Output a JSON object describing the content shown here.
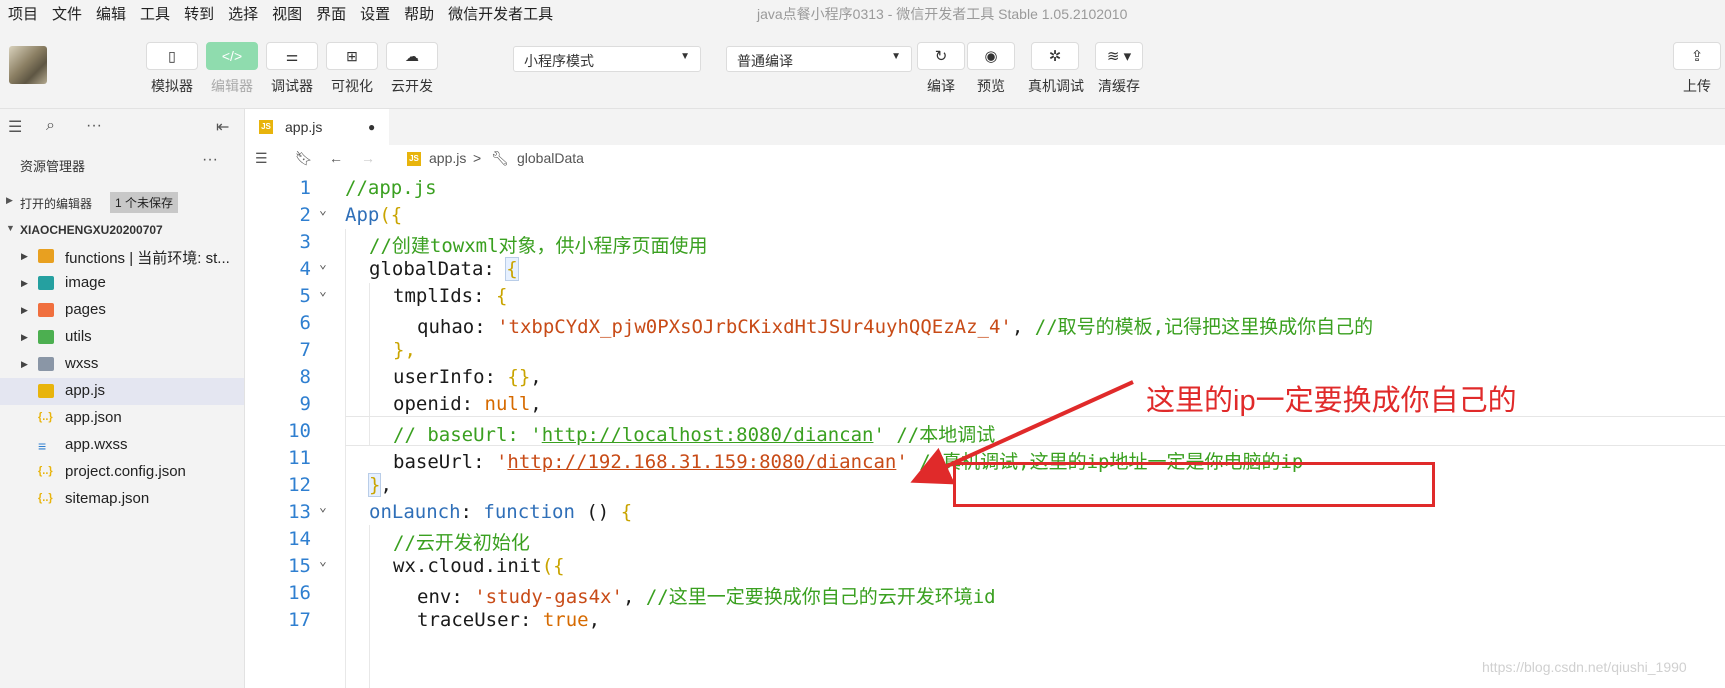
{
  "menu": [
    "项目",
    "文件",
    "编辑",
    "工具",
    "转到",
    "选择",
    "视图",
    "界面",
    "设置",
    "帮助",
    "微信开发者工具"
  ],
  "window_title": "java点餐小程序0313 - 微信开发者工具 Stable 1.05.2102010",
  "toolbar": {
    "simulator": "模拟器",
    "editor": "编辑器",
    "debugger": "调试器",
    "visual": "可视化",
    "cloud": "云开发",
    "mode_select": "小程序模式",
    "compile_select": "普通编译",
    "compile": "编译",
    "preview": "预览",
    "remote_debug": "真机调试",
    "clear_cache": "清缓存",
    "upload": "上传"
  },
  "explorer": {
    "title": "资源管理器",
    "open_editors": "打开的编辑器",
    "unsaved_badge": "1 个未保存",
    "project": "XIAOCHENGXU20200707",
    "items": [
      {
        "name": "functions | 当前环境: st...",
        "icon": "folder-functions-icon",
        "color": "#e8a020"
      },
      {
        "name": "image",
        "icon": "folder-image-icon",
        "color": "#25a0a0"
      },
      {
        "name": "pages",
        "icon": "folder-pages-icon",
        "color": "#f06f3e"
      },
      {
        "name": "utils",
        "icon": "folder-utils-icon",
        "color": "#4caf50"
      },
      {
        "name": "wxss",
        "icon": "folder-icon",
        "color": "#8a96a6"
      },
      {
        "name": "app.js",
        "icon": "js-file-icon",
        "color": "#e8b40c"
      },
      {
        "name": "app.json",
        "icon": "json-file-icon",
        "color": "#e8b40c"
      },
      {
        "name": "app.wxss",
        "icon": "css-file-icon",
        "color": "#2f7fd0"
      },
      {
        "name": "project.config.json",
        "icon": "json-file-icon",
        "color": "#e8b40c"
      },
      {
        "name": "sitemap.json",
        "icon": "json-file-icon",
        "color": "#e8b40c"
      }
    ]
  },
  "tab": {
    "name": "app.js",
    "modified": "●",
    "icon_text": "JS"
  },
  "breadcrumb": {
    "file": "app.js",
    "separator": ">",
    "symbol": "globalData"
  },
  "code": {
    "line_numbers": [
      "1",
      "2",
      "3",
      "4",
      "5",
      "6",
      "7",
      "8",
      "9",
      "10",
      "11",
      "12",
      "13",
      "14",
      "15",
      "16",
      "17"
    ],
    "l1": "//app.js",
    "l2_fn": "App",
    "l2_br": "({",
    "l3": "//创建towxml对象，供小程序页面使用",
    "l4_key": "globalData",
    "l4_colon": ": ",
    "l4_br": "{",
    "l5_key": "tmplIds",
    "l5_colon": ": ",
    "l5_br": "{",
    "l6_key": "quhao",
    "l6_colon": ": ",
    "l6_str": "'txbpCYdX_pjw0PXsOJrbCKixdHtJSUr4uyhQQEzAz_4'",
    "l6_comma": ", ",
    "l6_comment": "//取号的模板,记得把这里换成你自己的",
    "l7": "},",
    "l8_key": "userInfo",
    "l8_colon": ": ",
    "l8_br": "{}",
    "l8_comma": ",",
    "l9_key": "openid",
    "l9_colon": ": ",
    "l9_kw": "null",
    "l9_comma": ",",
    "l10_a": "// baseUrl: '",
    "l10_url": "http://localhost:8080/diancan",
    "l10_b": "' //本地调试",
    "l11_key": "baseUrl",
    "l11_colon": ": ",
    "l11_q1": "'",
    "l11_url": "http://192.168.31.159:8080/diancan",
    "l11_q2": "'",
    "l11_comment": "//真机调试,这里的ip地址一定是你电脑的ip",
    "l12_br": "}",
    "l12_comma": ",",
    "l13_key": "onLaunch",
    "l13_colon": ": ",
    "l13_kw": "function",
    "l13_paren": " () ",
    "l13_br": "{",
    "l14": "//云开发初始化",
    "l15_key": "wx.cloud.init",
    "l15_br": "({",
    "l16_key": "env",
    "l16_colon": ": ",
    "l16_str": "'study-gas4x'",
    "l16_comma": ", ",
    "l16_comment": "//这里一定要换成你自己的云开发环境id",
    "l17_key": "traceUser",
    "l17_colon": ": ",
    "l17_kw": "true",
    "l17_comma": ","
  },
  "annotation": {
    "callout": "这里的ip一定要换成你自己的",
    "color": "#e02a2a"
  },
  "watermark": "https://blog.csdn.net/qiushi_1990"
}
